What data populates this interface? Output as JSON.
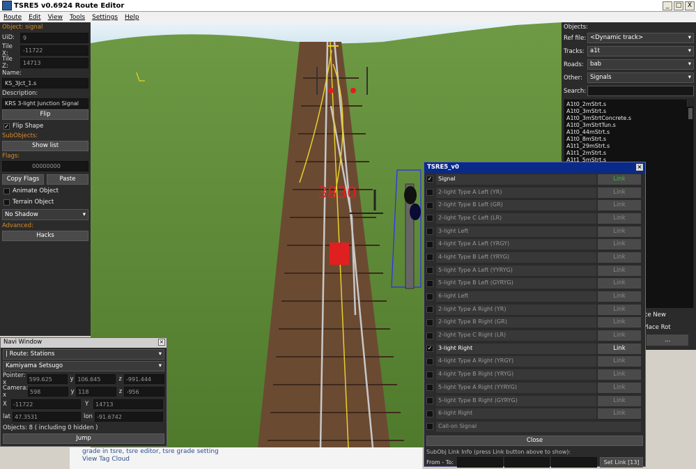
{
  "window": {
    "title": "TSRE5 v0.6924 Route Editor",
    "controls": [
      "_",
      "□",
      "X"
    ]
  },
  "menu": [
    "Route",
    "Edit",
    "View",
    "Tools",
    "Settings",
    "Help"
  ],
  "left": {
    "object_label": "Object: signal",
    "uid_label": "UiD:",
    "uid": "9",
    "tilex_label": "Tile X:",
    "tilex": "-11722",
    "tilez_label": "Tile Z:",
    "tilez": "14713",
    "name_label": "Name:",
    "name": "KS_3Jct_1.s",
    "desc_label": "Description:",
    "desc": "KRS 3-light Junction Signal",
    "flip": "Flip",
    "flip_shape": "Flip Shape",
    "subobjects_label": "SubObjects:",
    "show_list": "Show list",
    "flags_label": "Flags:",
    "flags": "00000000",
    "copy_flags": "Copy Flags",
    "paste": "Paste",
    "animate": "Animate Object",
    "terrain": "Terrain Object",
    "shadow": "No Shadow",
    "advanced_label": "Advanced:",
    "hacks": "Hacks"
  },
  "viewport": {
    "signal_id": "3830"
  },
  "right": {
    "objects_label": "Objects:",
    "ref_label": "Ref file:",
    "ref": "<Dynamic track>",
    "tracks_label": "Tracks:",
    "tracks": "a1t",
    "roads_label": "Roads:",
    "roads": "bab",
    "other_label": "Other:",
    "other": "Signals",
    "search_label": "Search:",
    "files": [
      "A1t0_2mStrt.s",
      "A1t0_3mStrt.s",
      "A1t0_3mStrtConcrete.s",
      "A1t0_3mStrtTun.s",
      "A1t0_44mStrt.s",
      "A1t0_8mStrt.s",
      "A1t1_29mStrt.s",
      "A1t1_2mStrt.s",
      "A1t1_5mStrt.s"
    ],
    "place_new": "Place New",
    "set_place_rot": "et Place Rot",
    "m_label": "m",
    "dots": "..."
  },
  "navi": {
    "title": "Navi Window",
    "route": "| Route: Stations",
    "place": "Kamiyama Setsugo",
    "pointer_label": "Pointer: x",
    "pointer_x": "599.625",
    "pointer_y": "106.645",
    "pointer_z": "-991.444",
    "camera_label": "Camera: x",
    "camera_x": "598",
    "camera_y": "118",
    "camera_z": "-956",
    "y": "y",
    "z": "z",
    "x_label": "X",
    "X": "-11722",
    "Y_label": "Y",
    "Y": "14713",
    "lat_label": "lat",
    "lat": "47.3531",
    "lon_label": "lon",
    "lon": "-91.6742",
    "objects": "Objects: 8 ( including 0 hidden )",
    "jump": "Jump"
  },
  "dialog": {
    "title": "TSRE5_v0",
    "rows": [
      {
        "name": "Signal",
        "link": "Link",
        "checked": true,
        "active": true,
        "green": true
      },
      {
        "name": "2-light Type A Left (YR)",
        "link": "Link",
        "checked": false
      },
      {
        "name": "2-light Type B Left (GR)",
        "link": "Link",
        "checked": false
      },
      {
        "name": "2-light Type C Left (LR)",
        "link": "Link",
        "checked": false
      },
      {
        "name": "3-light Left",
        "link": "Link",
        "checked": false
      },
      {
        "name": "4-light Type A Left (YRGY)",
        "link": "Link",
        "checked": false
      },
      {
        "name": "4-light Type B Left (YRYG)",
        "link": "Link",
        "checked": false
      },
      {
        "name": "5-light Type A Left (YYRYG)",
        "link": "Link",
        "checked": false
      },
      {
        "name": "5-light Type B Left (GYRYG)",
        "link": "Link",
        "checked": false
      },
      {
        "name": "6-light Left",
        "link": "Link",
        "checked": false
      },
      {
        "name": "2-light Type A Right (YR)",
        "link": "Link",
        "checked": false
      },
      {
        "name": "2-light Type B Right (GR)",
        "link": "Link",
        "checked": false
      },
      {
        "name": "2-light Type C Right (LR)",
        "link": "Link",
        "checked": false
      },
      {
        "name": "3-light Right",
        "link": "Link",
        "checked": true,
        "active": true
      },
      {
        "name": "4-light Type A Right (YRGY)",
        "link": "Link",
        "checked": false
      },
      {
        "name": "4-light Type B Right (YRYG)",
        "link": "Link",
        "checked": false
      },
      {
        "name": "5-light Type A Right (YYRYG)",
        "link": "Link",
        "checked": false
      },
      {
        "name": "5-light Type B Right (GYRYG)",
        "link": "Link",
        "checked": false
      },
      {
        "name": "6-light Right",
        "link": "Link",
        "checked": false
      },
      {
        "name": "Call-on Signal",
        "link": "",
        "checked": false
      }
    ],
    "close": "Close",
    "info": "SubObj Link Info (press Link button above to show):",
    "from_to": "From - To:",
    "set_link": "Set Link [13]"
  },
  "background_page": {
    "line1": "grade in tsre, tsre editor, tsre grade setting",
    "line2": "View Tag Cloud"
  },
  "colors": {
    "panel": "#2b2b2b",
    "dialog_title": "#0a2a8a",
    "link_active_green": "#3cb83c",
    "signal_red": "#e02020",
    "track_yellow": "#e8d02a"
  }
}
